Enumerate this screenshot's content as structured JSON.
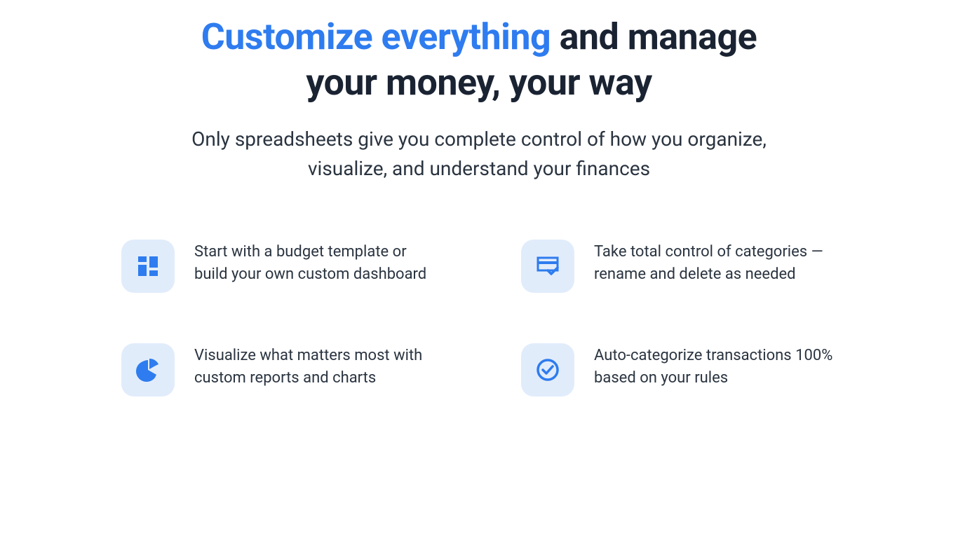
{
  "heading": {
    "highlight": "Customize everything",
    "rest": " and manage your money, your way"
  },
  "subheading": "Only spreadsheets give you complete control of how you organize, visualize, and understand your finances",
  "features": [
    {
      "text": "Start with a budget template or build your own custom dashboard"
    },
    {
      "text": "Take total control of categories — rename and delete as needed"
    },
    {
      "text": "Visualize what matters most with custom reports and charts"
    },
    {
      "text": "Auto-categorize transactions 100% based on your rules"
    }
  ],
  "colors": {
    "accent": "#2e7cef",
    "iconbg": "#e1ecfb",
    "text": "#1a2332"
  }
}
